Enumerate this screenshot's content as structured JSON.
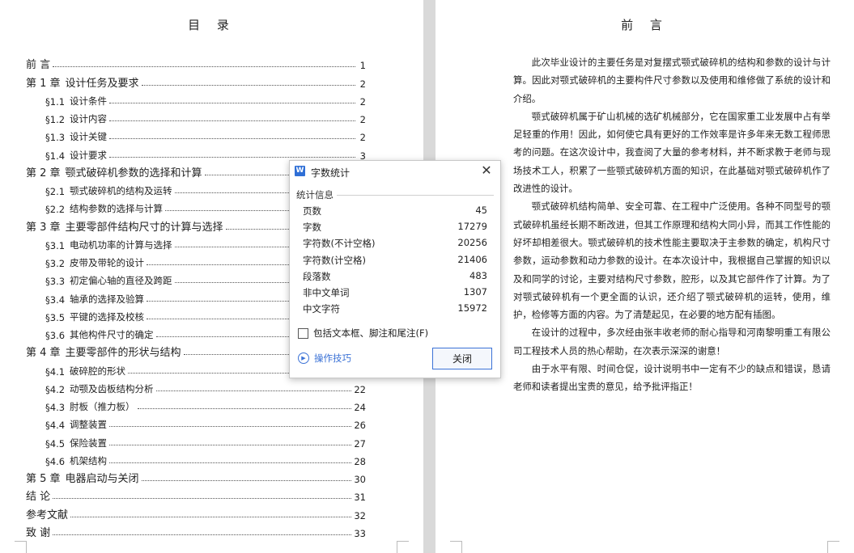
{
  "toc": {
    "title": "目 录",
    "entries": [
      {
        "num": "",
        "label": "前 言",
        "page": "1",
        "level": 1
      },
      {
        "num": "第 1 章",
        "label": "设计任务及要求",
        "page": "2",
        "level": 1
      },
      {
        "num": "§1.1",
        "label": "设计条件",
        "page": "2",
        "level": 2
      },
      {
        "num": "§1.2",
        "label": "设计内容",
        "page": "2",
        "level": 2
      },
      {
        "num": "§1.3",
        "label": "设计关键",
        "page": "2",
        "level": 2
      },
      {
        "num": "§1.4",
        "label": "设计要求",
        "page": "3",
        "level": 2
      },
      {
        "num": "第 2 章",
        "label": "颚式破碎机参数的选择和计算",
        "page": "",
        "level": 1
      },
      {
        "num": "§2.1",
        "label": "颚式破碎机的结构及运转",
        "page": "",
        "level": 2
      },
      {
        "num": "§2.2",
        "label": "结构参数的选择与计算",
        "page": "",
        "level": 2
      },
      {
        "num": "第 3 章",
        "label": "主要零部件结构尺寸的计算与选择",
        "page": "",
        "level": 1
      },
      {
        "num": "§3.1",
        "label": "电动机功率的计算与选择",
        "page": "",
        "level": 2
      },
      {
        "num": "§3.2",
        "label": "皮带及带轮的设计",
        "page": "",
        "level": 2
      },
      {
        "num": "§3.3",
        "label": "初定偏心轴的直径及跨距",
        "page": "",
        "level": 2
      },
      {
        "num": "§3.4",
        "label": "轴承的选择及验算",
        "page": "",
        "level": 2
      },
      {
        "num": "§3.5",
        "label": "平键的选择及校核",
        "page": "",
        "level": 2
      },
      {
        "num": "§3.6",
        "label": "其他构件尺寸的确定",
        "page": "",
        "level": 2
      },
      {
        "num": "第 4 章",
        "label": "主要零部件的形状与结构",
        "page": "",
        "level": 1
      },
      {
        "num": "§4.1",
        "label": "破碎腔的形状",
        "page": "",
        "level": 2
      },
      {
        "num": "§4.2",
        "label": "动颚及齿板结构分析",
        "page": "22",
        "level": 2
      },
      {
        "num": "§4.3",
        "label": "肘板（推力板）",
        "page": "24",
        "level": 2
      },
      {
        "num": "§4.4",
        "label": "调整装置",
        "page": "26",
        "level": 2
      },
      {
        "num": "§4.5",
        "label": "保险装置",
        "page": "27",
        "level": 2
      },
      {
        "num": "§4.6",
        "label": "机架结构",
        "page": "28",
        "level": 2
      },
      {
        "num": "第 5 章",
        "label": "电器启动与关闭",
        "page": "30",
        "level": 1
      },
      {
        "num": "",
        "label": "结 论",
        "page": "31",
        "level": 1
      },
      {
        "num": "",
        "label": "参考文献",
        "page": "32",
        "level": 1
      },
      {
        "num": "",
        "label": "致 谢",
        "page": "33",
        "level": 1
      }
    ]
  },
  "preface": {
    "title": "前 言",
    "paragraphs": [
      "此次毕业设计的主要任务是对复摆式颚式破碎机的结构和参数的设计与计算。因此对颚式破碎机的主要构件尺寸参数以及使用和维修做了系统的设计和介绍。",
      "颚式破碎机属于矿山机械的选矿机械部分，它在国家重工业发展中占有举足轻重的作用！因此，如何使它具有更好的工作效率是许多年来无数工程师思考的问题。在这次设计中，我查阅了大量的参考材料，并不断求教于老师与现场技术工人，积累了一些颚式破碎机方面的知识，在此基础对颚式破碎机作了改进性的设计。",
      "颚式破碎机结构简单、安全可靠、在工程中广泛使用。各种不同型号的颚式破碎机虽经长期不断改进，但其工作原理和结构大同小异，而其工作性能的好坏却相差很大。颚式破碎机的技术性能主要取决于主参数的确定，机构尺寸参数，运动参数和动力参数的设计。在本次设计中，我根据自己掌握的知识以及和同学的讨论，主要对结构尺寸参数，腔形，以及其它部件作了计算。为了对颚式破碎机有一个更全面的认识，还介绍了颚式破碎机的运转，使用，维护，检修等方面的内容。为了清楚起见，在必要的地方配有插图。",
      "在设计的过程中，多次经由张丰收老师的耐心指导和河南黎明重工有限公司工程技术人员的热心帮助，在次表示深深的谢意！",
      "由于水平有限、时间仓促，设计说明书中一定有不少的缺点和错误，恳请老师和读者提出宝贵的意见，给予批评指正！"
    ]
  },
  "dialog": {
    "icon_name": "wps-writer-icon",
    "title": "字数统计",
    "section": "统计信息",
    "stats": [
      {
        "label": "页数",
        "value": "45"
      },
      {
        "label": "字数",
        "value": "17279"
      },
      {
        "label": "字符数(不计空格)",
        "value": "20256"
      },
      {
        "label": "字符数(计空格)",
        "value": "21406"
      },
      {
        "label": "段落数",
        "value": "483"
      },
      {
        "label": "非中文单词",
        "value": "1307"
      },
      {
        "label": "中文字符",
        "value": "15972"
      }
    ],
    "checkbox_label": "包括文本框、脚注和尾注(F)",
    "checkbox_checked": false,
    "tips_label": "操作技巧",
    "close_label": "关闭",
    "accent_color": "#3b72d6"
  }
}
